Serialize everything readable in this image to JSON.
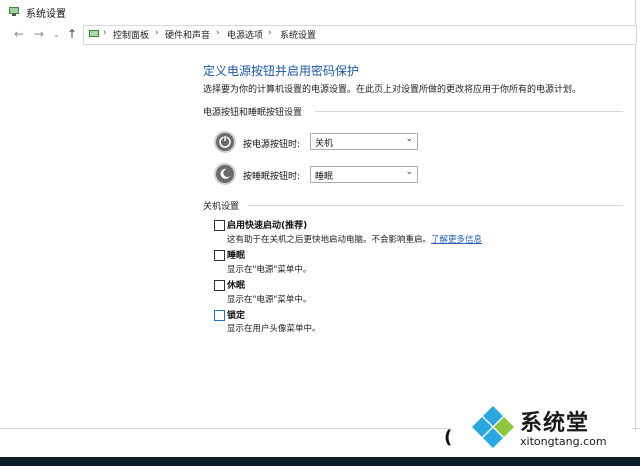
{
  "window": {
    "title": "系统设置"
  },
  "address": {
    "crumbs": [
      "控制面板",
      "硬件和声音",
      "电源选项",
      "系统设置"
    ]
  },
  "page": {
    "heading": "定义电源按钮并启用密码保护",
    "description": "选择要为你的计算机设置的电源设置。在此页上对设置所做的更改将应用于你所有的电源计划。",
    "power_section": "电源按钮和睡眠按钮设置",
    "power_button_label": "按电源按钮时:",
    "power_button_value": "关机",
    "sleep_button_label": "按睡眠按钮时:",
    "sleep_button_value": "睡眠",
    "shutdown_section": "关机设置",
    "options": [
      {
        "label": "启用快速启动(推荐)",
        "desc": "这有助于在关机之后更快地启动电脑。不会影响重启。",
        "link": "了解更多信息"
      },
      {
        "label": "睡眠",
        "desc": "显示在\"电源\"菜单中。"
      },
      {
        "label": "休眠",
        "desc": "显示在\"电源\"菜单中。"
      },
      {
        "label": "锁定",
        "desc": "显示在用户头像菜单中。"
      }
    ]
  },
  "watermark": {
    "name": "系统堂",
    "url": "xitongtang.com"
  },
  "colors": {
    "heading": "#1e57a8",
    "link": "#1f5fc1",
    "taskbar": "#0f1d2b"
  }
}
